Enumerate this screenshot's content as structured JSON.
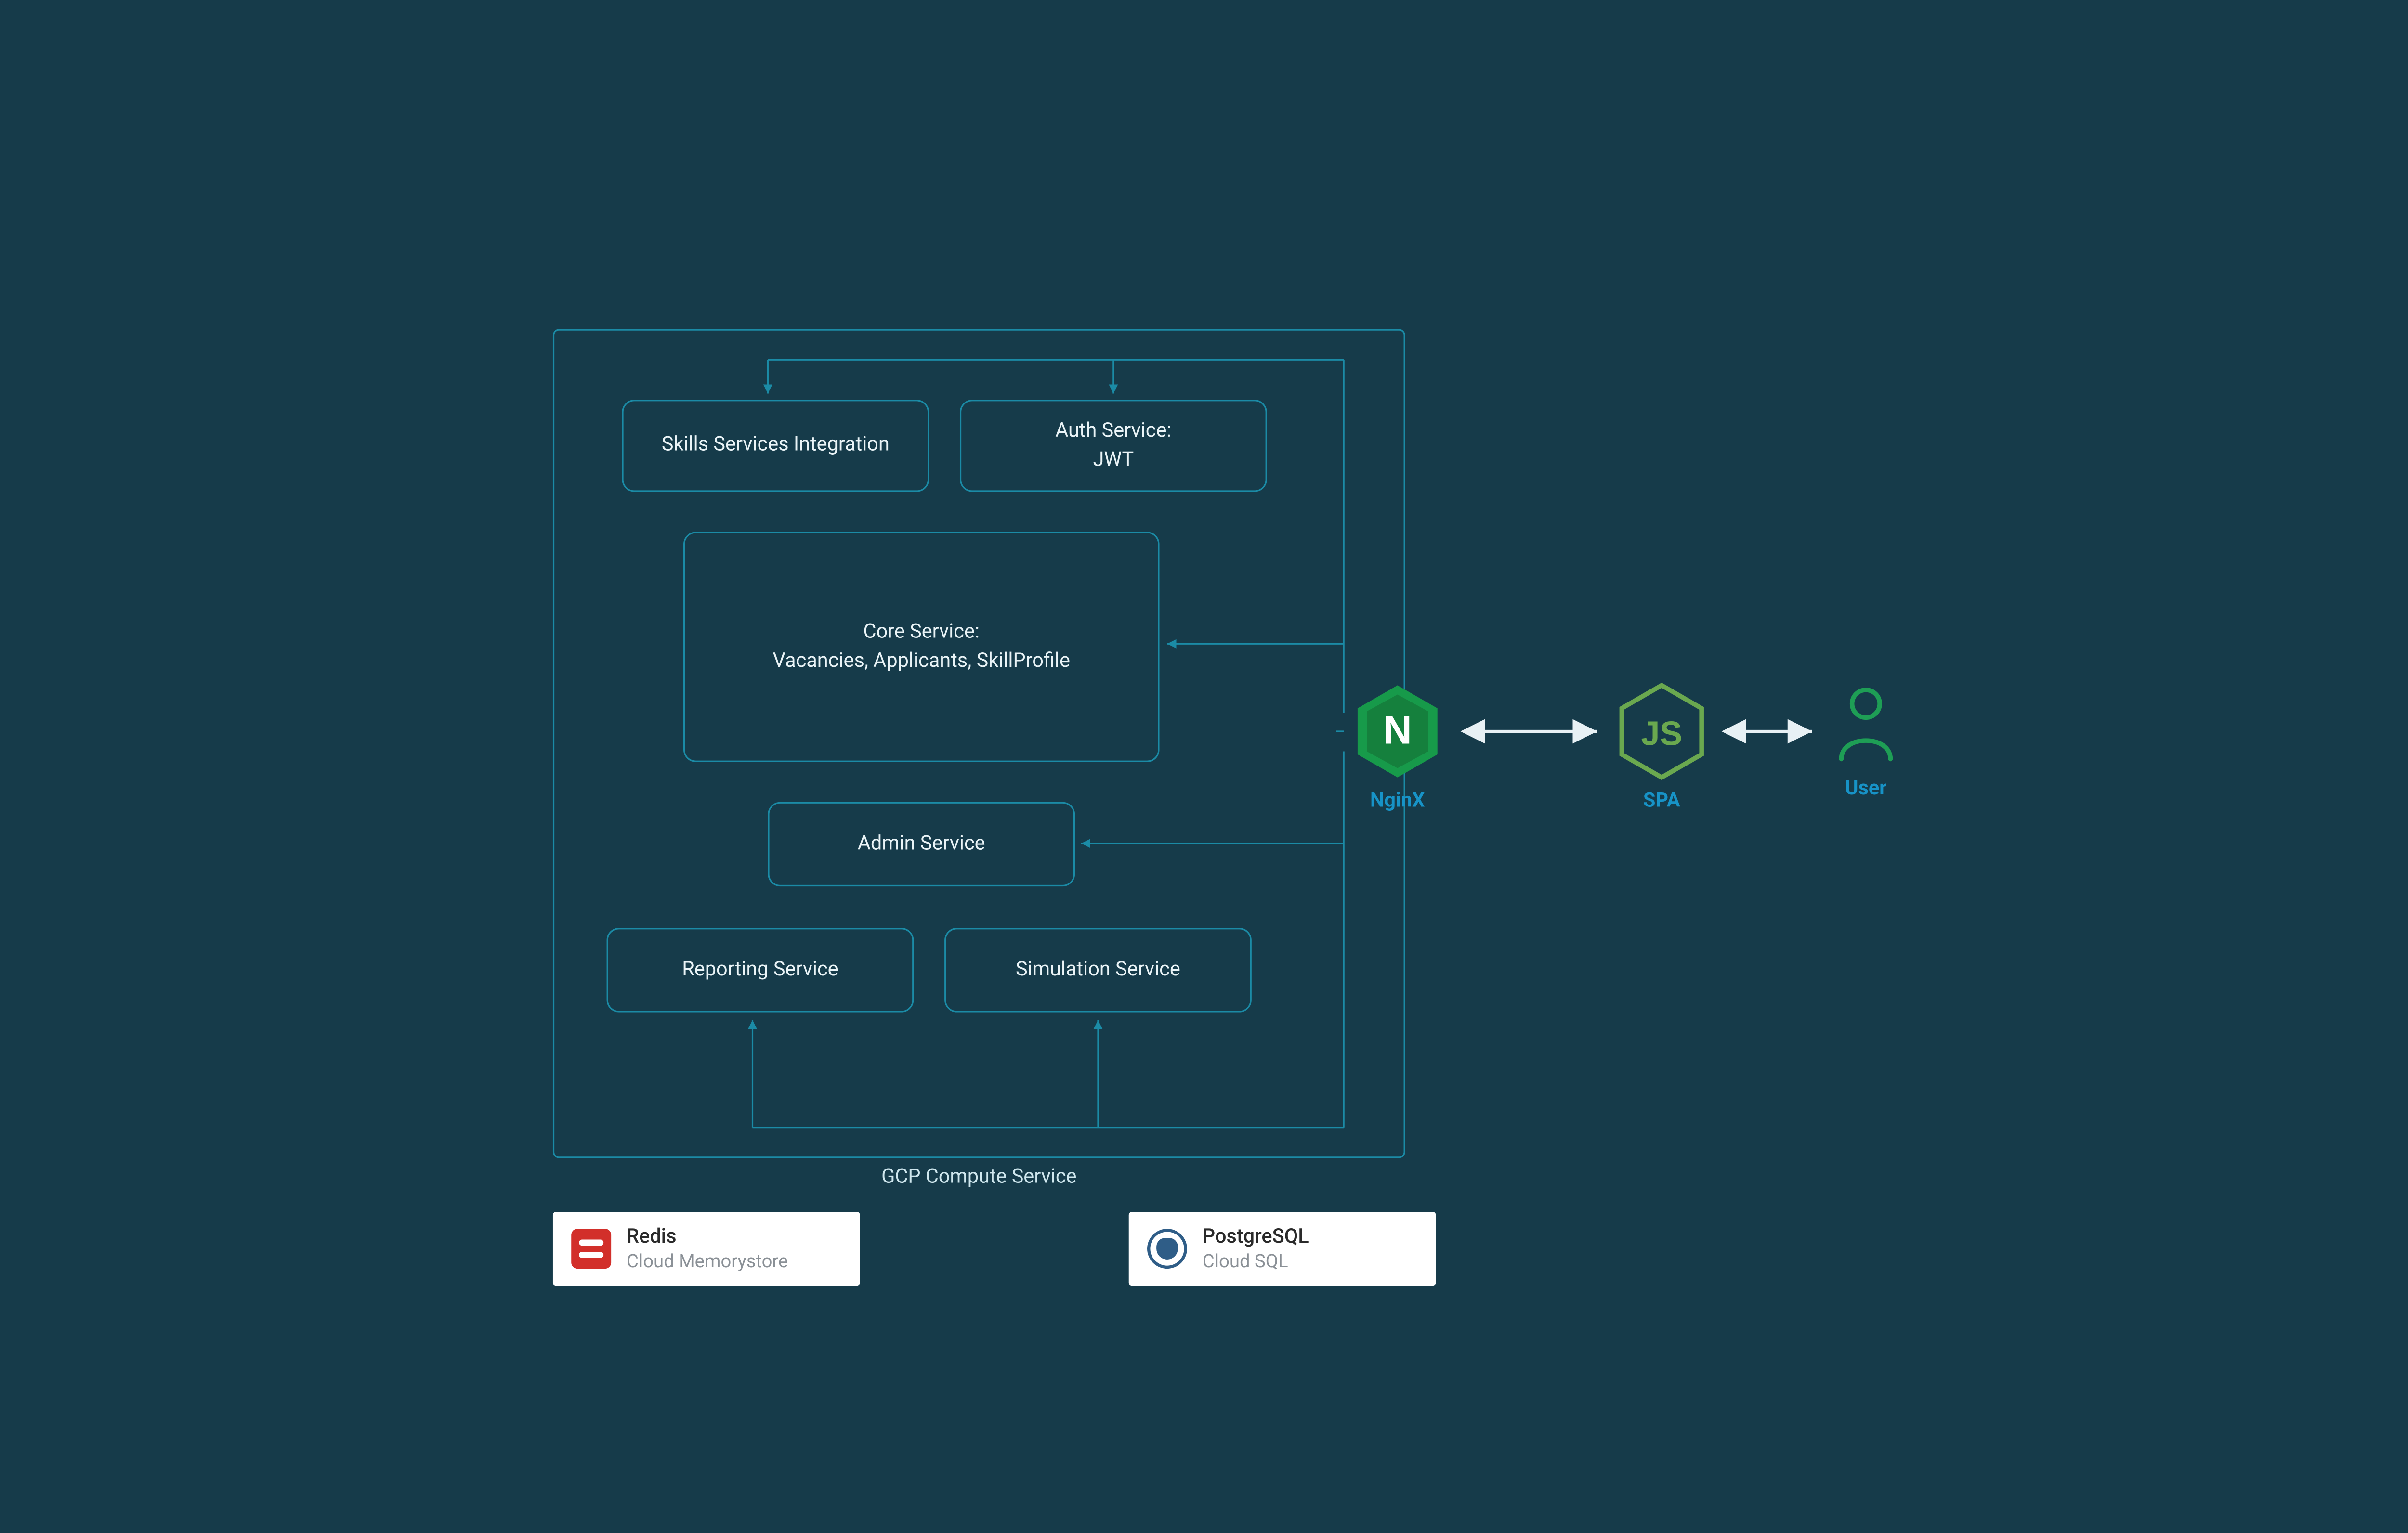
{
  "compute": {
    "label": "GCP Compute Service"
  },
  "services": {
    "skills": {
      "label": "Skills Services Integration"
    },
    "auth": {
      "line1": "Auth Service:",
      "line2": "JWT"
    },
    "core": {
      "line1": "Core Service:",
      "line2": "Vacancies, Applicants, SkillProfile"
    },
    "admin": {
      "label": "Admin Service"
    },
    "report": {
      "label": "Reporting Service"
    },
    "sim": {
      "label": "Simulation Service"
    }
  },
  "nodes": {
    "nginx": {
      "label": "NginX",
      "letter": "N"
    },
    "spa": {
      "label": "SPA",
      "letters": "JS"
    },
    "user": {
      "label": "User"
    }
  },
  "cards": {
    "redis": {
      "title": "Redis",
      "sub": "Cloud Memorystore"
    },
    "pg": {
      "title": "PostgreSQL",
      "sub": "Cloud SQL"
    }
  },
  "colors": {
    "bg": "#163b4a",
    "box_border": "#1b8ba6",
    "label_accent": "#1793c7",
    "nginx_green": "#179a4a",
    "node_green": "#6aa84f",
    "user_green": "#1e9e55",
    "arrow": "#e8f1f5",
    "connector": "#1b8ba6"
  }
}
